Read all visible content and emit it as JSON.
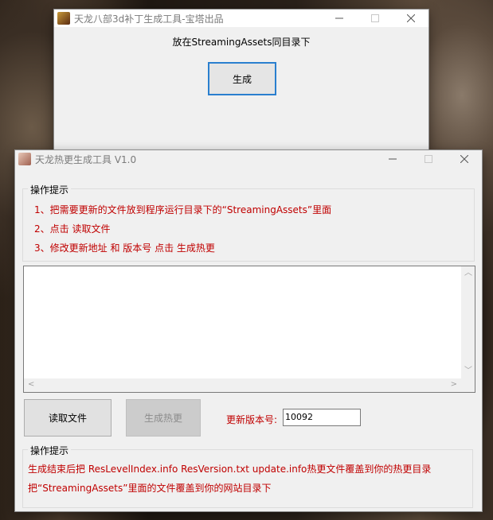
{
  "window1": {
    "title": "天龙八部3d补丁生成工具-宝塔出品",
    "hint": "放在StreamingAssets同目录下",
    "generate_button": "生成"
  },
  "window2": {
    "title": "天龙热更生成工具 V1.0",
    "group1": {
      "legend": "操作提示",
      "lines": [
        "1、把需要更新的文件放到程序运行目录下的“StreamingAssets”里面",
        "2、点击 读取文件",
        "3、修改更新地址 和 版本号  点击 生成热更"
      ]
    },
    "read_button": "读取文件",
    "generate_hot_button": "生成热更",
    "version_label": "更新版本号:",
    "version_value": "10092",
    "group2": {
      "legend": "操作提示",
      "lines": [
        "生成结束后把 ResLevelIndex.info ResVersion.txt update.info热更文件覆盖到你的热更目录",
        "把“StreamingAssets”里面的文件覆盖到你的网站目录下"
      ]
    }
  },
  "colors": {
    "hint_red": "#c00000",
    "focus_blue": "#2a7fcf",
    "window_bg": "#f0f0f0"
  },
  "icons": [
    "app-icon",
    "minimize-icon",
    "maximize-icon",
    "close-icon",
    "scroll-up-icon",
    "scroll-down-icon",
    "scroll-left-icon",
    "scroll-right-icon"
  ]
}
